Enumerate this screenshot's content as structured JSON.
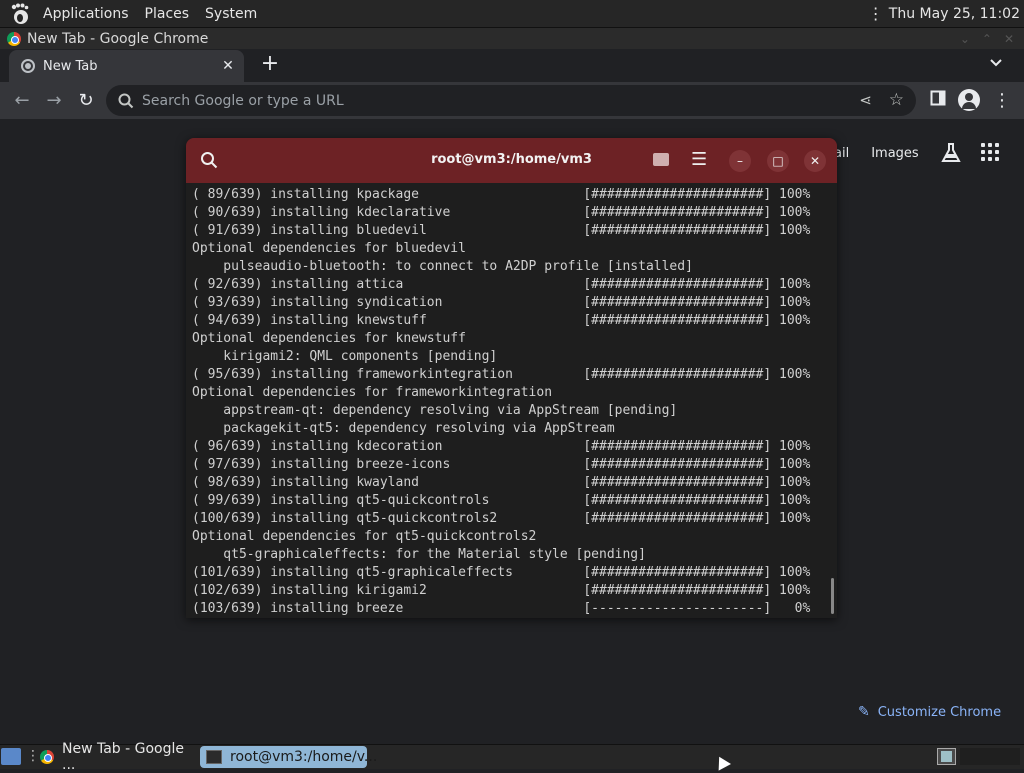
{
  "top_panel": {
    "menus": [
      "Applications",
      "Places",
      "System"
    ],
    "clock": "Thu May 25, 11:02"
  },
  "chrome": {
    "window_title": "New Tab - Google Chrome",
    "tab_title": "New Tab",
    "tab_close": "✕",
    "new_tab": "+",
    "omnibox_placeholder": "Search Google or type a URL",
    "ntp_links": [
      "ail",
      "Images"
    ],
    "customize_label": "Customize Chrome"
  },
  "terminal": {
    "title": "root@vm3:/home/vm3",
    "lines": [
      "( 89/639) installing kpackage                     [######################] 100%",
      "( 90/639) installing kdeclarative                 [######################] 100%",
      "( 91/639) installing bluedevil                    [######################] 100%",
      "Optional dependencies for bluedevil",
      "    pulseaudio-bluetooth: to connect to A2DP profile [installed]",
      "( 92/639) installing attica                       [######################] 100%",
      "( 93/639) installing syndication                  [######################] 100%",
      "( 94/639) installing knewstuff                    [######################] 100%",
      "Optional dependencies for knewstuff",
      "    kirigami2: QML components [pending]",
      "( 95/639) installing frameworkintegration         [######################] 100%",
      "Optional dependencies for frameworkintegration",
      "    appstream-qt: dependency resolving via AppStream [pending]",
      "    packagekit-qt5: dependency resolving via AppStream",
      "( 96/639) installing kdecoration                  [######################] 100%",
      "( 97/639) installing breeze-icons                 [######################] 100%",
      "( 98/639) installing kwayland                     [######################] 100%",
      "( 99/639) installing qt5-quickcontrols            [######################] 100%",
      "(100/639) installing qt5-quickcontrols2           [######################] 100%",
      "Optional dependencies for qt5-quickcontrols2",
      "    qt5-graphicaleffects: for the Material style [pending]",
      "(101/639) installing qt5-graphicaleffects         [######################] 100%",
      "(102/639) installing kirigami2                    [######################] 100%",
      "(103/639) installing breeze                       [----------------------]   0%"
    ]
  },
  "taskbar": {
    "chrome_task": "New Tab - Google ...",
    "terminal_task": "root@vm3:/home/v..."
  },
  "colors": {
    "terminal_header": "#6d2225",
    "terminal_bg": "#1e1e1e",
    "chrome_toolbar": "#35363a",
    "link_blue": "#8ab4f8"
  }
}
